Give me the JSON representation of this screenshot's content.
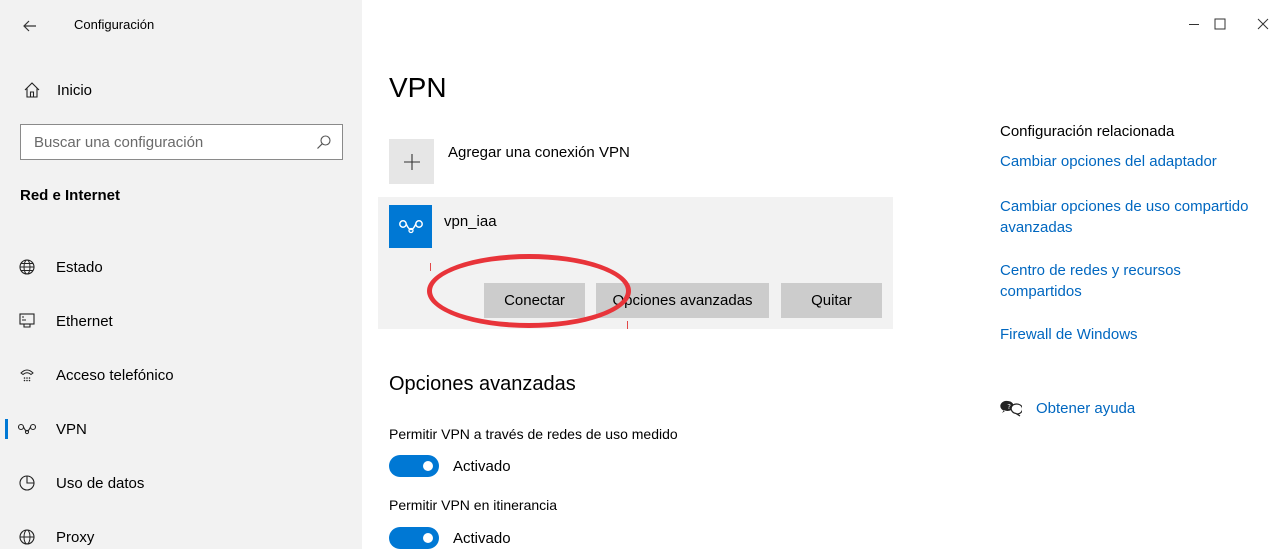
{
  "window": {
    "title": "Configuración",
    "controls": {
      "minimize": "minimize-icon",
      "maximize": "maximize-icon",
      "close": "close-icon"
    }
  },
  "sidebar": {
    "home_label": "Inicio",
    "search_placeholder": "Buscar una configuración",
    "section_title": "Red e Internet",
    "items": [
      {
        "label": "Estado",
        "icon": "globe-status-icon",
        "active": false
      },
      {
        "label": "Ethernet",
        "icon": "ethernet-icon",
        "active": false
      },
      {
        "label": "Acceso telefónico",
        "icon": "dial-up-icon",
        "active": false
      },
      {
        "label": "VPN",
        "icon": "vpn-icon",
        "active": true
      },
      {
        "label": "Uso de datos",
        "icon": "data-usage-icon",
        "active": false
      },
      {
        "label": "Proxy",
        "icon": "globe-icon",
        "active": false
      }
    ]
  },
  "main": {
    "title": "VPN",
    "add_vpn_label": "Agregar una conexión VPN",
    "connection": {
      "name": "vpn_iaa",
      "buttons": {
        "connect": "Conectar",
        "advanced": "Opciones avanzadas",
        "remove": "Quitar"
      }
    },
    "advanced": {
      "title": "Opciones avanzadas",
      "settings": [
        {
          "label": "Permitir VPN a través de redes de uso medido",
          "state": "Activado",
          "on": true
        },
        {
          "label": "Permitir VPN en itinerancia",
          "state": "Activado",
          "on": true
        }
      ]
    }
  },
  "related": {
    "title": "Configuración relacionada",
    "links": [
      "Cambiar opciones del adaptador",
      "Cambiar opciones de uso compartido avanzadas",
      "Centro de redes y recursos compartidos",
      "Firewall de Windows"
    ],
    "help": "Obtener ayuda"
  },
  "colors": {
    "accent": "#0078d4",
    "link": "#0067c0",
    "annotation": "#e8343a",
    "sidebar_bg": "#f2f2f2"
  }
}
